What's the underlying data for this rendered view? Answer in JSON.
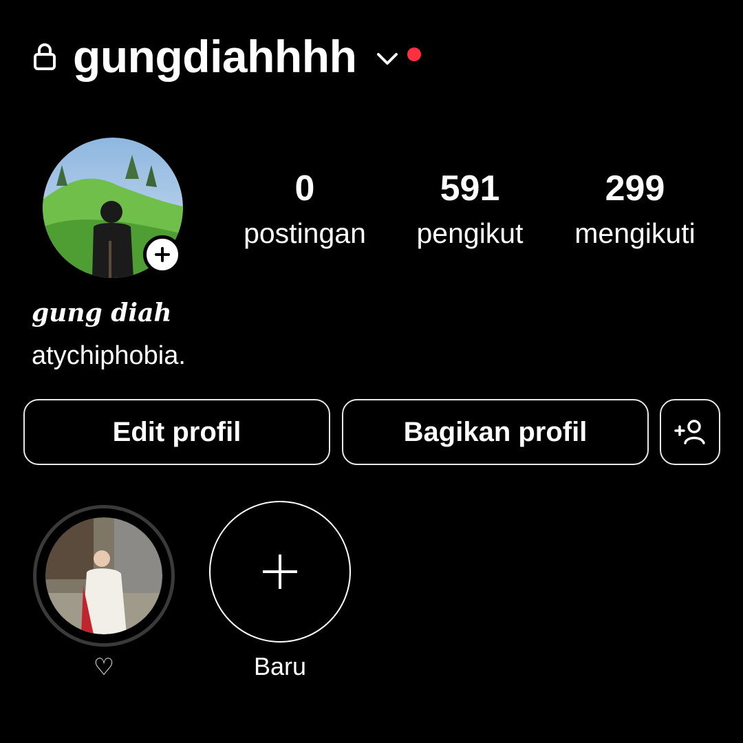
{
  "header": {
    "username": "gungdiahhhh",
    "lock_icon": "lock-icon",
    "chevron_icon": "chevron-down-icon",
    "notification_dot_color": "#ff3040"
  },
  "profile": {
    "add_story_icon": "plus-icon",
    "display_name": "gung diah",
    "bio": "atychiphobia."
  },
  "stats": [
    {
      "value": "0",
      "label": "postingan"
    },
    {
      "value": "591",
      "label": "pengikut"
    },
    {
      "value": "299",
      "label": "mengikuti"
    }
  ],
  "actions": {
    "edit_label": "Edit profil",
    "share_label": "Bagikan profil",
    "discover_icon": "add-person-icon"
  },
  "highlights": [
    {
      "label": "♡"
    },
    {
      "label": "Baru",
      "icon": "plus-icon"
    }
  ]
}
